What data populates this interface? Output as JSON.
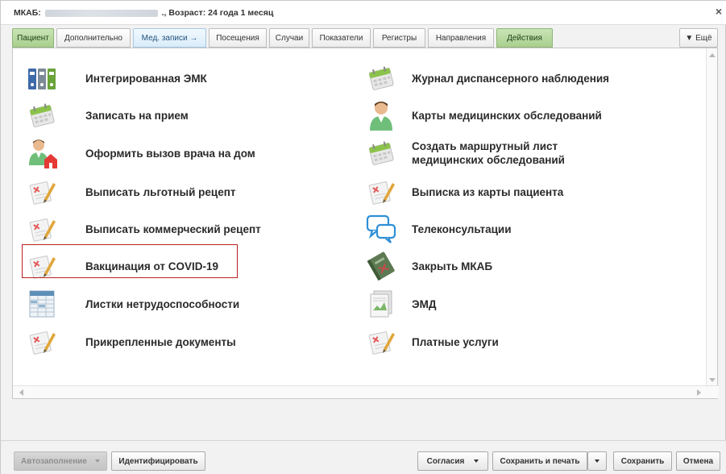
{
  "window": {
    "title_prefix": "МКАБ:",
    "title_suffix": "., Возраст: 24 года 1 месяц"
  },
  "tabs": [
    {
      "label": "Пациент",
      "style": "green"
    },
    {
      "label": "Дополнительно",
      "style": "plain"
    },
    {
      "label": "Мед. записи →",
      "style": "light"
    },
    {
      "label": "Посещения",
      "style": "plain"
    },
    {
      "label": "Случаи",
      "style": "plain"
    },
    {
      "label": "Показатели",
      "style": "plain"
    },
    {
      "label": "Регистры",
      "style": "plain"
    },
    {
      "label": "Направления",
      "style": "plain"
    },
    {
      "label": "Действия",
      "style": "green"
    }
  ],
  "tab_more": "▼ Ещё",
  "actions_left": [
    {
      "label": "Интегрированная ЭМК",
      "icon": "folders-icon"
    },
    {
      "label": "Записать на прием",
      "icon": "calendar-icon"
    },
    {
      "label": "Оформить вызов врача на дом",
      "icon": "doctor-home-icon"
    },
    {
      "label": "Выписать льготный рецепт",
      "icon": "prescription-icon"
    },
    {
      "label": "Выписать коммерческий рецепт",
      "icon": "prescription-icon"
    },
    {
      "label": "Вакцинация от COVID-19",
      "icon": "prescription-icon"
    },
    {
      "label": "Листки нетрудоспособности",
      "icon": "spreadsheet-icon"
    },
    {
      "label": "Прикрепленные документы",
      "icon": "prescription-icon"
    }
  ],
  "actions_right": [
    {
      "label": "Журнал диспансерного наблюдения",
      "icon": "calendar-icon"
    },
    {
      "label": "Карты медицинских обследований",
      "icon": "doctor-icon"
    },
    {
      "label": "Создать маршрутный лист медицинских обследований",
      "icon": "calendar-icon"
    },
    {
      "label": "Выписка из карты пациента",
      "icon": "prescription-icon"
    },
    {
      "label": "Телеконсультации",
      "icon": "chat-icon"
    },
    {
      "label": "Закрыть МКАБ",
      "icon": "book-icon"
    },
    {
      "label": "ЭМД",
      "icon": "document-icon"
    },
    {
      "label": "Платные услуги",
      "icon": "prescription-icon"
    }
  ],
  "footer": {
    "autofill": "Автозаполнение",
    "identify": "Идентифицировать",
    "consent": "Согласия",
    "save_print": "Сохранить и печать",
    "save": "Сохранить",
    "cancel": "Отмена"
  },
  "colors": {
    "tab_green": "#a9cf8e",
    "tab_light": "#d9ecfa",
    "highlight": "#b81f1f"
  }
}
